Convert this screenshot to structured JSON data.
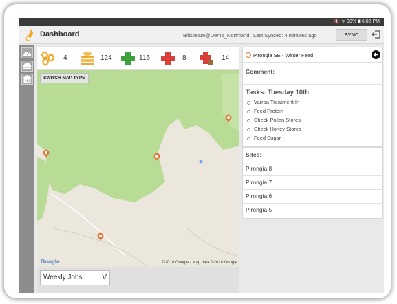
{
  "status_bar": {
    "text": "🔇 ᯤ 99% ▮ 6:02 PM"
  },
  "header": {
    "title": "Dashboard",
    "account": "BillsTeam@Demo_Northland",
    "last_synced": "Last Synced:  4 minutes ago",
    "sync_label": "SYNC",
    "brand_color": "#f0a92e"
  },
  "stats": [
    {
      "icon": "hive-group-icon",
      "value": "4",
      "color": "#f0a92e"
    },
    {
      "icon": "hive-stack-icon",
      "value": "124",
      "color": "#f0a92e"
    },
    {
      "icon": "green-cross-icon",
      "value": "116",
      "color": "#3da23d"
    },
    {
      "icon": "red-cross-icon",
      "value": "8",
      "color": "#d9403a"
    },
    {
      "icon": "red-cross-flag-icon",
      "value": "14",
      "color": "#d9403a"
    }
  ],
  "map": {
    "switch_label": "SWITCH MAP TYPE",
    "google_label": "Google",
    "credit": "©2018 Google - Map data ©2018 Google"
  },
  "filter": {
    "selected": "Weekly Jobs",
    "chevron": "V"
  },
  "detail": {
    "site_title": "Pirongia SE - Winter Feed",
    "comment_label": "Comment:",
    "tasks_title": "Tasks: Tuesday 10th",
    "tasks": [
      "Varroa Treatment In",
      "Feed Protein",
      "Check Pollen Stores",
      "Check Honey Stores",
      "Feed Sugar"
    ]
  },
  "sites": {
    "title": "Sites:",
    "items": [
      "Pirongia 8",
      "Pirongia 7",
      "Pirongia 6",
      "Pirongia 5"
    ]
  }
}
